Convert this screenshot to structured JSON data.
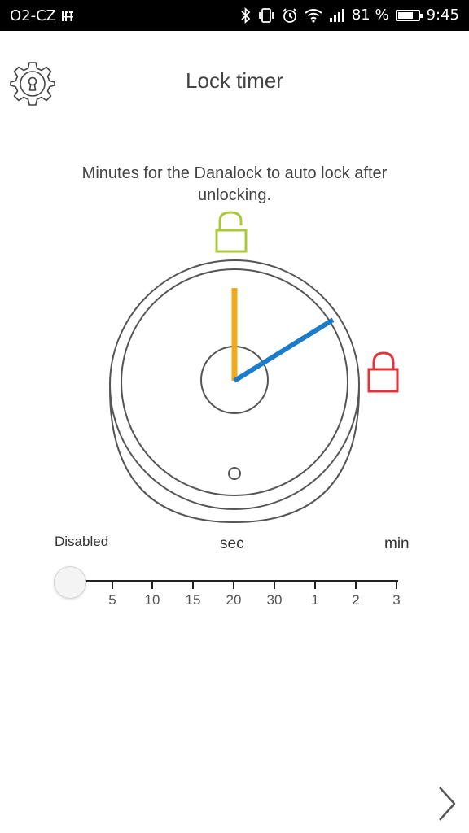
{
  "status_bar": {
    "carrier": "O2-CZ",
    "battery_percent": "81 %",
    "battery_level": 0.81,
    "time": "9:45",
    "icons": [
      "carrier-extra-icon",
      "bluetooth-icon",
      "vibrate-icon",
      "alarm-icon",
      "wifi-icon",
      "signal-icon",
      "battery-icon"
    ]
  },
  "header": {
    "title": "Lock timer",
    "settings_icon": "gear-lock-icon"
  },
  "instruction": "Minutes for the Danalock to auto lock after unlocking.",
  "dial": {
    "unlocked_icon": "unlocked-padlock-icon",
    "locked_icon": "locked-padlock-icon",
    "colors": {
      "unlocked": "#a9c93a",
      "locked": "#e0343c",
      "start_hand": "#f2a91c",
      "timer_hand": "#1b7cc9",
      "outline": "#555555"
    }
  },
  "slider": {
    "disabled_label": "Disabled",
    "sec_label": "sec",
    "min_label": "min",
    "ticks": [
      "5",
      "10",
      "15",
      "20",
      "30",
      "1",
      "2",
      "3"
    ],
    "selected": "Disabled"
  },
  "footer": {
    "next_icon": "chevron-right-icon"
  }
}
